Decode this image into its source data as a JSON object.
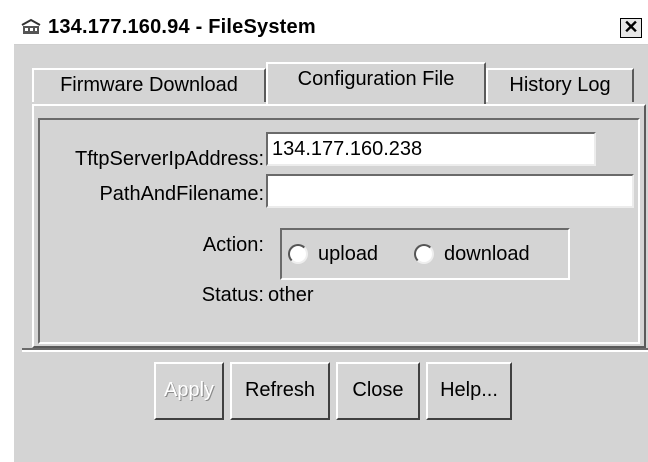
{
  "window": {
    "title": "134.177.160.94 - FileSystem",
    "close_label": "✕"
  },
  "tabs": [
    {
      "label": "Firmware Download",
      "active": false
    },
    {
      "label": "Configuration File",
      "active": true
    },
    {
      "label": "History Log",
      "active": false
    }
  ],
  "form": {
    "tftp_label": "TftpServerIpAddress:",
    "tftp_value": "134.177.160.238",
    "path_label": "PathAndFilename:",
    "path_value": "",
    "action_label": "Action:",
    "action_options": [
      "upload",
      "download"
    ],
    "action_selected": "",
    "status_label": "Status:",
    "status_value": "other"
  },
  "buttons": {
    "apply": "Apply",
    "refresh": "Refresh",
    "close": "Close",
    "help": "Help..."
  }
}
